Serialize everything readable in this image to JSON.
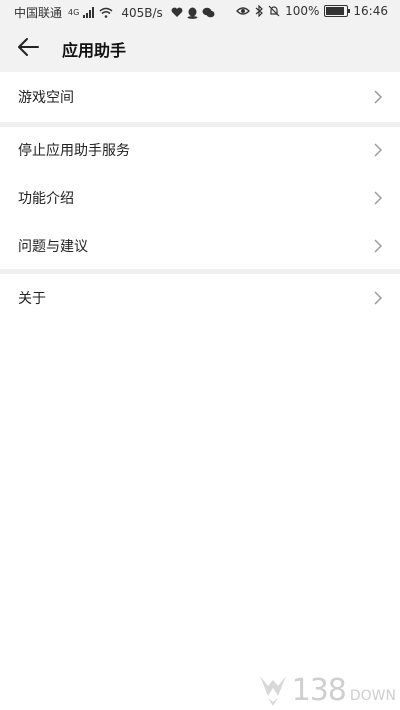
{
  "statusbar": {
    "carrier": "中国联通",
    "network": "4G",
    "speed": "405B/s",
    "battery_pct": "100%",
    "time": "16:46"
  },
  "header": {
    "title": "应用助手"
  },
  "groups": [
    {
      "items": [
        {
          "label": "游戏空间"
        }
      ]
    },
    {
      "items": [
        {
          "label": "停止应用助手服务"
        },
        {
          "label": "功能介绍"
        },
        {
          "label": "问题与建议"
        }
      ]
    },
    {
      "items": [
        {
          "label": "关于"
        }
      ]
    }
  ],
  "watermark": {
    "number": "138",
    "suffix": "DOWN"
  },
  "colors": {
    "background": "#ffffff",
    "header_bg": "#f2f2f2",
    "divider": "#efefef",
    "chevron": "#9a9a9a"
  }
}
